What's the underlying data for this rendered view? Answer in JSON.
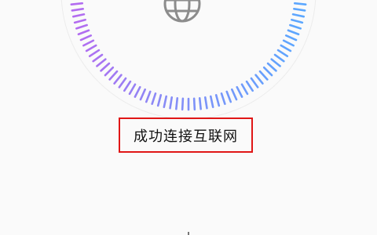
{
  "connection": {
    "status_text": "成功连接互联网",
    "state_icon": "globe-icon"
  },
  "dial": {
    "progress_fraction": 1.0,
    "gradient_start": "#a970f2",
    "gradient_end": "#5aa8ff"
  },
  "colors": {
    "highlight_border": "#e01616",
    "icon": "#888888",
    "background": "#fafafa"
  }
}
